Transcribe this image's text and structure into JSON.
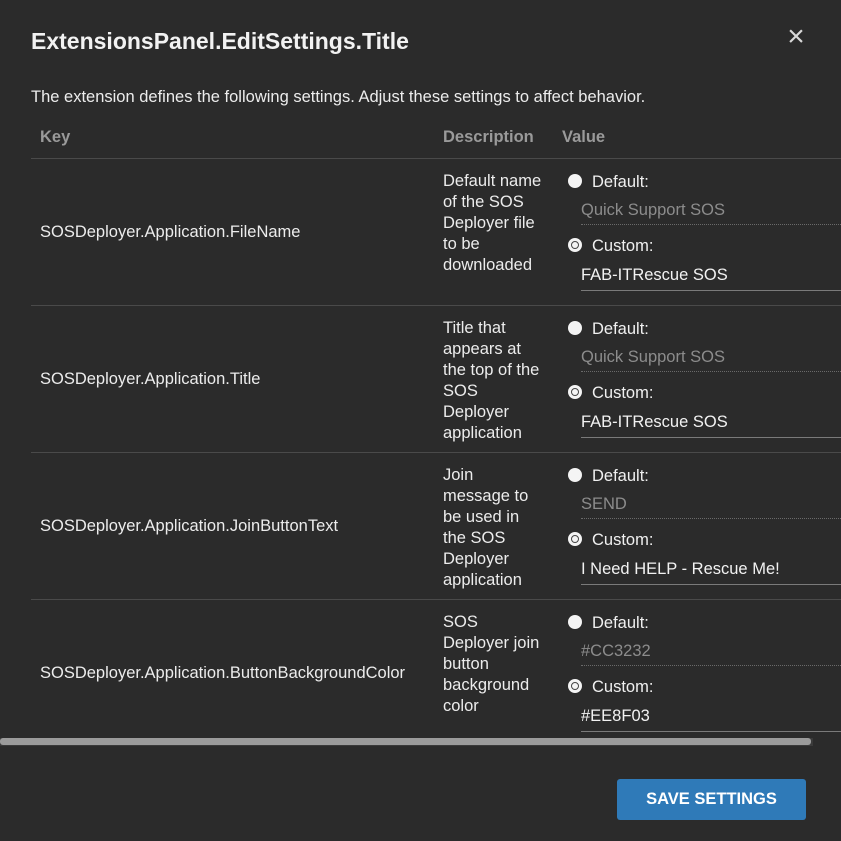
{
  "dialog": {
    "title": "ExtensionsPanel.EditSettings.Title",
    "close_icon": "×",
    "description": "The extension defines the following settings. Adjust these settings to affect behavior."
  },
  "table": {
    "headers": {
      "key": "Key",
      "description": "Description",
      "value": "Value"
    },
    "default_label": "Default:",
    "custom_label": "Custom:",
    "rows": [
      {
        "key": "SOSDeployer.Application.FileName",
        "description": "Default name of the SOS Deployer file to be downloaded",
        "default_value": "Quick Support SOS",
        "custom_value": "FAB-ITRescue SOS",
        "selected": "custom"
      },
      {
        "key": "SOSDeployer.Application.Title",
        "description": "Title that appears at the top of the SOS Deployer application",
        "default_value": "Quick Support SOS",
        "custom_value": "FAB-ITRescue SOS",
        "selected": "custom"
      },
      {
        "key": "SOSDeployer.Application.JoinButtonText",
        "description": "Join message to be used in the SOS Deployer application",
        "default_value": "SEND",
        "custom_value": "I Need HELP - Rescue Me!",
        "selected": "custom"
      },
      {
        "key": "SOSDeployer.Application.ButtonBackgroundColor",
        "description": "SOS Deployer join button background color",
        "default_value": "#CC3232",
        "custom_value": "#EE8F03",
        "selected": "custom"
      }
    ]
  },
  "footer": {
    "save_label": "SAVE SETTINGS"
  },
  "colors": {
    "background": "#2b2b2b",
    "accent": "#2f7ab8"
  }
}
